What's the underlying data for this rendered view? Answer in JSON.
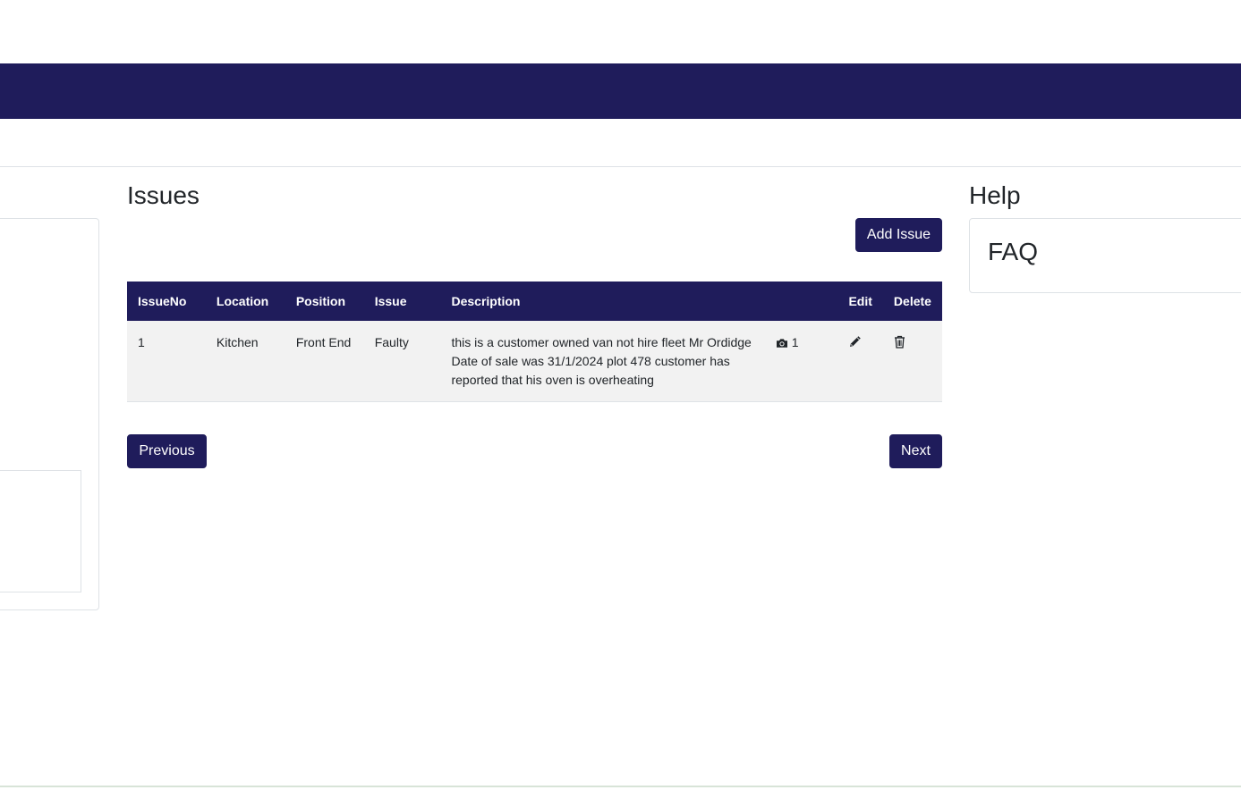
{
  "issues": {
    "title": "Issues",
    "add_label": "Add Issue",
    "columns": [
      "IssueNo",
      "Location",
      "Position",
      "Issue",
      "Description",
      "",
      "Edit",
      "Delete"
    ],
    "rows": [
      {
        "issue_no": "1",
        "location": "Kitchen",
        "position": "Front End",
        "issue": "Faulty",
        "description": "this is a customer owned van not hire fleet Mr Ordidge Date of sale was 31/1/2024 plot 478 customer has reported that his oven is overheating",
        "photo_count": "1",
        "photo_icon": "camera-icon",
        "edit_icon": "pencil-icon",
        "delete_icon": "trash-icon"
      }
    ],
    "previous_label": "Previous",
    "next_label": "Next"
  },
  "help": {
    "title": "Help",
    "faq_title": "FAQ"
  },
  "colors": {
    "brand": "#1f1c5b",
    "row_bg": "#f2f2f2"
  }
}
